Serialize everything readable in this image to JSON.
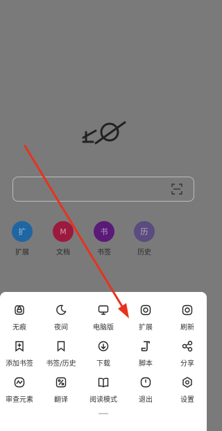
{
  "home": {
    "search": {
      "placeholder": ""
    },
    "quick_links": [
      {
        "label": "扩展",
        "glyph": "扩",
        "color": "#1f66a3"
      },
      {
        "label": "文档",
        "glyph": "M",
        "color": "#9b1a3d"
      },
      {
        "label": "书签",
        "glyph": "书",
        "color": "#5a1a78"
      },
      {
        "label": "历史",
        "glyph": "历",
        "color": "#5b4b7e"
      }
    ]
  },
  "menu": {
    "rows": [
      [
        {
          "label": "无痕",
          "icon": "lock-icon"
        },
        {
          "label": "夜间",
          "icon": "moon-icon"
        },
        {
          "label": "电脑版",
          "icon": "monitor-icon"
        },
        {
          "label": "扩展",
          "icon": "extension-icon"
        },
        {
          "label": "刷新",
          "icon": "refresh-icon"
        }
      ],
      [
        {
          "label": "添加书签",
          "icon": "add-bookmark-icon"
        },
        {
          "label": "书签/历史",
          "icon": "bookmark-icon"
        },
        {
          "label": "下载",
          "icon": "download-icon"
        },
        {
          "label": "脚本",
          "icon": "script-icon"
        },
        {
          "label": "分享",
          "icon": "share-icon"
        }
      ],
      [
        {
          "label": "审查元素",
          "icon": "inspect-icon"
        },
        {
          "label": "翻译",
          "icon": "translate-icon"
        },
        {
          "label": "阅读模式",
          "icon": "book-icon"
        },
        {
          "label": "退出",
          "icon": "power-icon"
        },
        {
          "label": "设置",
          "icon": "settings-icon"
        }
      ]
    ]
  },
  "annotation": {
    "arrow_color": "#e8321e"
  }
}
